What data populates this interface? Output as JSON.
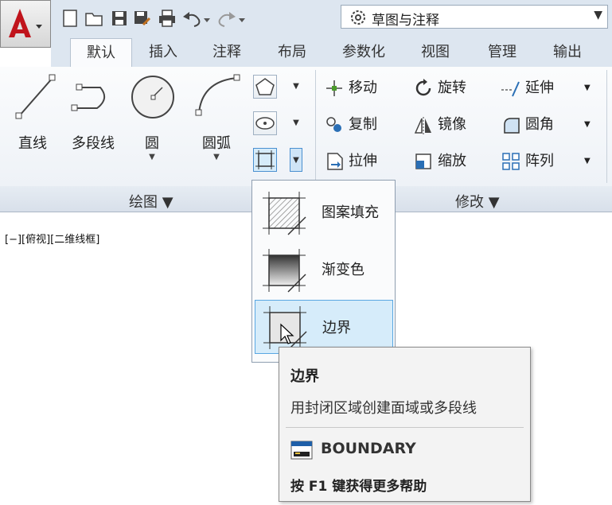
{
  "workspace": {
    "label": "草图与注释"
  },
  "tabs": [
    "默认",
    "插入",
    "注释",
    "布局",
    "参数化",
    "视图",
    "管理",
    "输出"
  ],
  "draw": {
    "line": "直线",
    "polyline": "多段线",
    "circle": "圆",
    "arc": "圆弧",
    "panel_title": "绘图 ▼"
  },
  "modify": {
    "move": "移动",
    "rotate": "旋转",
    "extend": "延伸",
    "copy": "复制",
    "mirror": "镜像",
    "fillet": "圆角",
    "stretch": "拉伸",
    "scale": "缩放",
    "array": "阵列",
    "panel_title": "修改 ▼"
  },
  "viewport": {
    "label": "[−][俯视][二维线框]"
  },
  "dropdown": {
    "hatch": "图案填充",
    "gradient": "渐变色",
    "boundary": "边界"
  },
  "tooltip": {
    "title": "边界",
    "description": "用封闭区域创建面域或多段线",
    "command": "BOUNDARY",
    "help": "按 F1 键获得更多帮助"
  },
  "colors": {
    "accent_red": "#c0141c",
    "ribbon_blue": "#dde6f0",
    "highlight": "#d6ecfa"
  }
}
